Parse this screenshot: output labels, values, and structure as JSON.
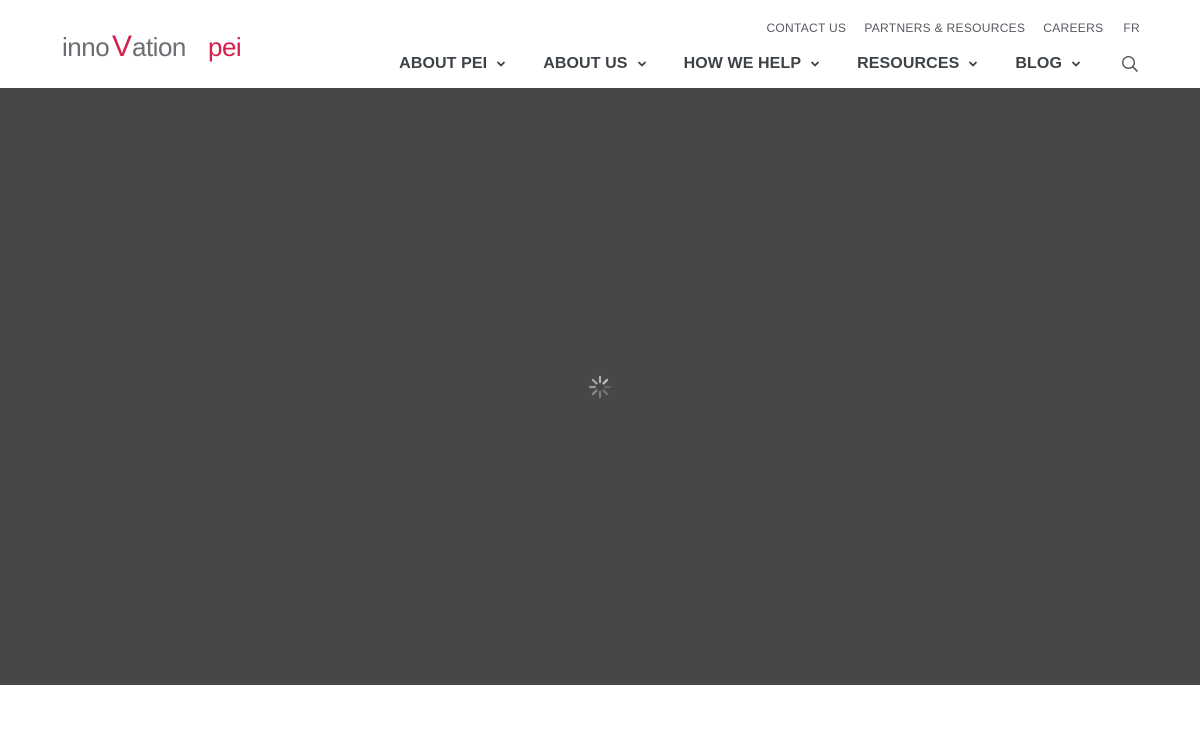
{
  "brand": {
    "logo_text_1": "inno",
    "logo_text_v": "V",
    "logo_text_2": "ation",
    "logo_text_3": "pei",
    "accent_color": "#d81e4b",
    "text_color": "#6b6e72"
  },
  "utility_nav": [
    {
      "label": "CONTACT US"
    },
    {
      "label": "PARTNERS & RESOURCES"
    },
    {
      "label": "CAREERS"
    },
    {
      "label": "FR"
    }
  ],
  "main_nav": [
    {
      "label": "ABOUT PEI",
      "icon": "chevron-down-icon"
    },
    {
      "label": "ABOUT US",
      "icon": "chevron-down-icon"
    },
    {
      "label": "HOW WE HELP",
      "icon": "chevron-down-icon"
    },
    {
      "label": "RESOURCES",
      "icon": "chevron-down-icon"
    },
    {
      "label": "BLOG",
      "icon": "chevron-down-icon"
    }
  ],
  "search": {
    "icon": "search-icon"
  },
  "stage": {
    "state": "loading",
    "icon": "loading-spinner-icon",
    "background": "#474747"
  }
}
